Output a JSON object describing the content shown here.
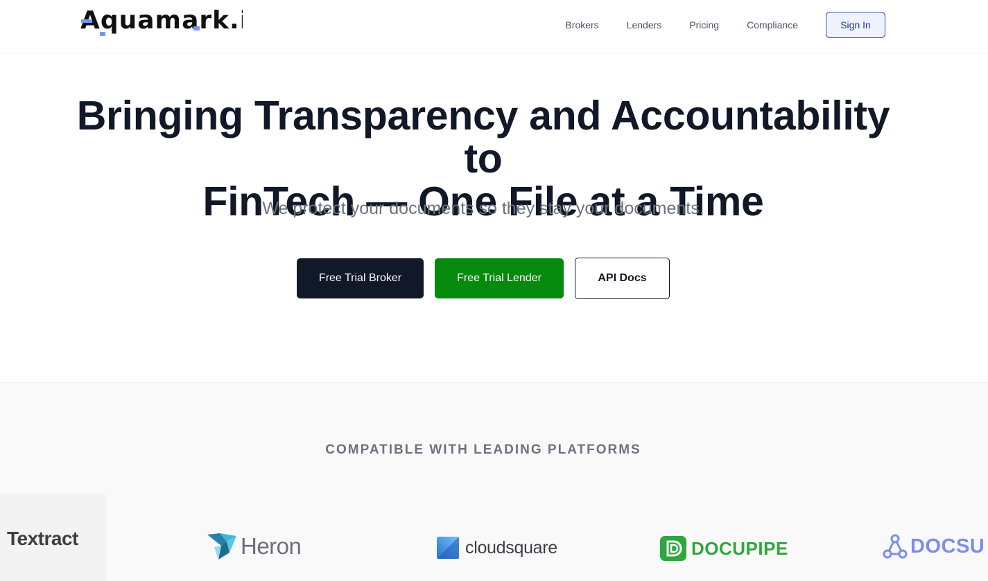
{
  "header": {
    "logo_text": "Aquamark.io",
    "nav": [
      "Brokers",
      "Lenders",
      "Pricing",
      "Compliance"
    ],
    "sign_in": "Sign In"
  },
  "hero": {
    "title_line1": "Bringing Transparency and Accountability to",
    "title_line2": "FinTech — One File at a Time",
    "subtitle": "We protect your documents so they stay your documents.",
    "buttons": {
      "broker": "Free Trial Broker",
      "lender": "Free Trial Lender",
      "api": "API Docs"
    }
  },
  "platforms": {
    "title": "COMPATIBLE WITH LEADING PLATFORMS",
    "logos": [
      "Textract",
      "Heron",
      "cloudsquare",
      "DOCUPIPE",
      "DOCSU"
    ]
  },
  "colors": {
    "primary_dark": "#111827",
    "lender_green": "#058a0e",
    "signin_blue": "#2d4fa0",
    "logo_accent": "#7d94ee",
    "docupipe_green": "#2fa63f",
    "docsu_blue": "#7b8cf0"
  },
  "icons": [
    "heron-bird-icon",
    "cloudsquare-icon",
    "docupipe-icon",
    "docsu-icon"
  ]
}
